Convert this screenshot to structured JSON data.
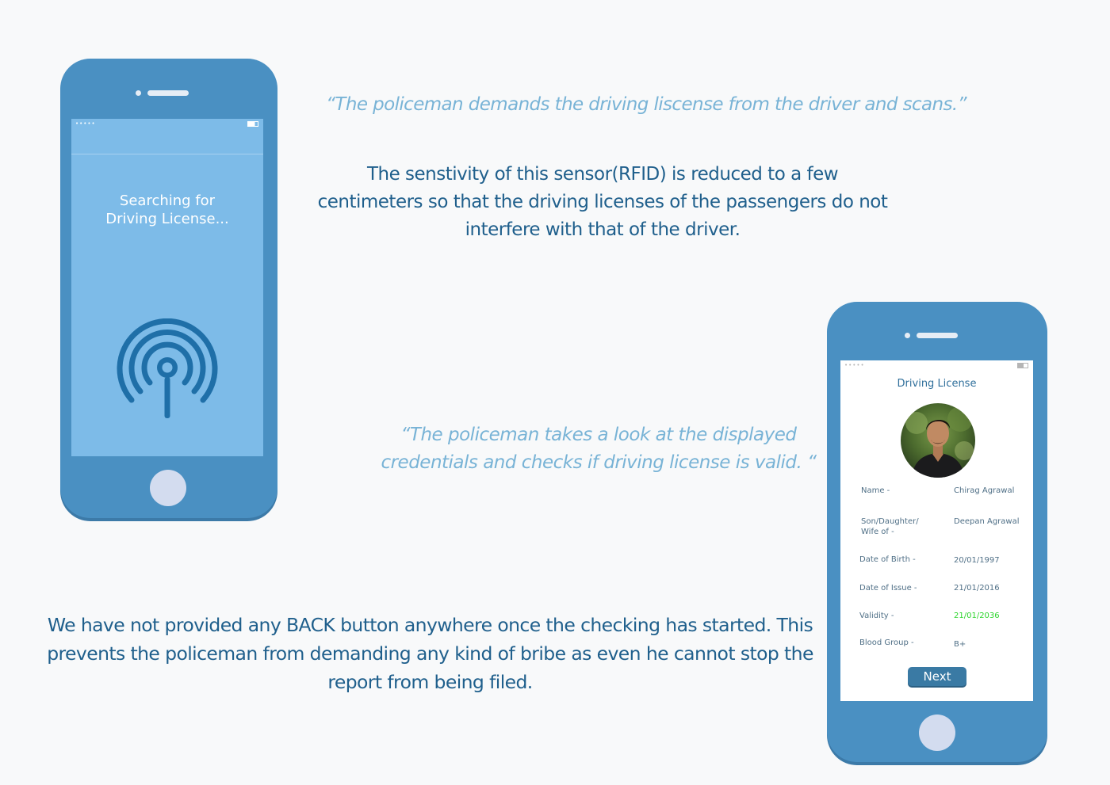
{
  "phone1": {
    "status_dots": "•••••",
    "search_text": "Searching for\nDriving License...",
    "icon": "rfid-signal-icon"
  },
  "quote1": "“The policeman demands the driving liscense from the driver and scans.”",
  "para1": "The senstivity of this sensor(RFID) is reduced to a few centimeters so that the driving licenses of the passengers do not interfere with that of the driver.",
  "quote2": "“The policeman takes a look at the displayed credentials and checks if driving license is valid. “",
  "para2": "We have not provided any BACK button anywhere once the checking has started. This prevents the policeman from demanding any kind of bribe as even he cannot stop the report from being filed.",
  "phone2": {
    "status_dots": "•••••",
    "title": "Driving License",
    "fields": [
      {
        "label": "Name -",
        "value": "Chirag Agrawal"
      },
      {
        "label": "Son/Daughter/\nWife of -",
        "value": "Deepan Agrawal"
      },
      {
        "label": "Date of Birth -",
        "value": "20/01/1997"
      },
      {
        "label": "Date of Issue -",
        "value": "21/01/2016"
      },
      {
        "label": "Validity -",
        "value": "21/01/2036"
      },
      {
        "label": "Blood Group -",
        "value": "B+"
      }
    ],
    "next_label": "Next"
  },
  "colors": {
    "phone_body": "#4a90c2",
    "scan_screen": "#7dbbe8",
    "quote_text": "#78b3d6",
    "body_text": "#1f5f8c",
    "valid_green": "#2bd52b",
    "next_button": "#3a7aa4"
  }
}
